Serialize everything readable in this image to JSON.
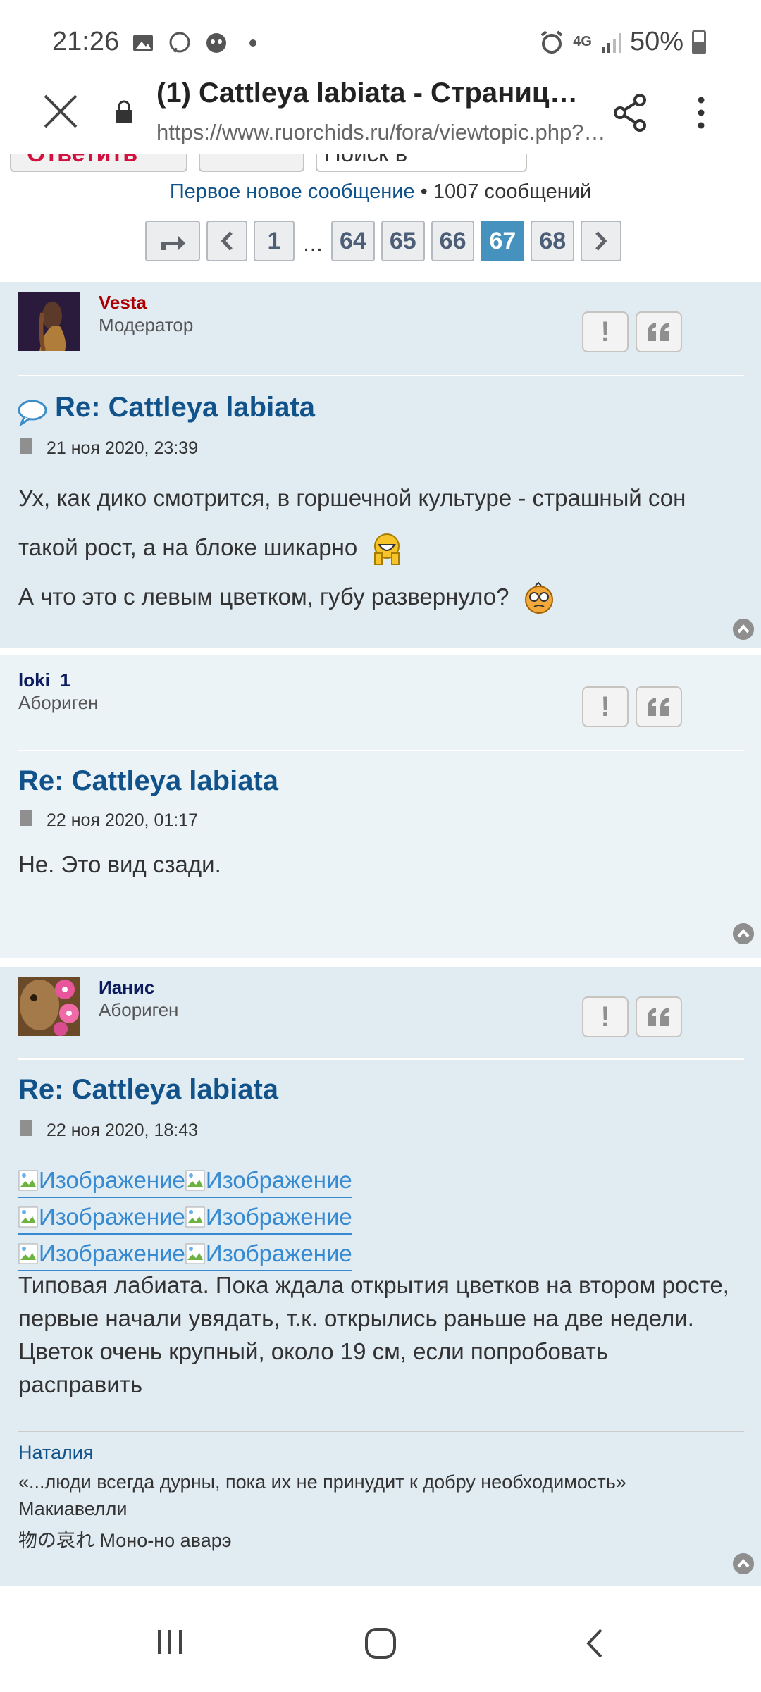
{
  "status_bar": {
    "time": "21:26",
    "battery": "50%",
    "network": "4G",
    "icons_left": [
      "image-icon",
      "viber-icon",
      "ghost-icon",
      "dot-icon"
    ],
    "icons_right": [
      "alarm-icon",
      "data-4g-icon",
      "signal-icon",
      "battery-icon"
    ]
  },
  "browser": {
    "title": "(1) Cattleya labiata - Страница 6…",
    "url": "https://www.ruorchids.ru/fora/viewtopic.php?…"
  },
  "toolbar": {
    "reply_label": "Ответить",
    "search_placeholder": "Поиск в"
  },
  "topic_info": {
    "first_new": "Первое новое сообщение",
    "separator": " • ",
    "count": "1007 сообщений"
  },
  "pagination": {
    "pages": [
      "1",
      "64",
      "65",
      "66",
      "67",
      "68"
    ],
    "ellipsis": "…",
    "current_page": "67"
  },
  "posts": [
    {
      "author": "Vesta",
      "author_color": "#aa0000",
      "rank": "Модератор",
      "title": "Re: Cattleya labiata",
      "date": "21 ноя 2020, 23:39",
      "lines": [
        "Ух, как дико смотрится, в горшечной культуре - страшный сон",
        "такой рост, а на блоке шикарно",
        "А что это с левым цветком, губу развернуло?"
      ]
    },
    {
      "author": "loki_1",
      "author_color": "#0b1b5e",
      "rank": "Абориген",
      "title": "Re: Cattleya labiata",
      "date": "22 ноя 2020, 01:17",
      "lines": [
        "Не. Это вид сзади."
      ]
    },
    {
      "author": "Ианис",
      "author_color": "#0b1b5e",
      "rank": "Абориген",
      "title": "Re: Cattleya labiata",
      "date": "22 ноя 2020, 18:43",
      "image_alt": "Изображение",
      "text": "Типовая лабиата. Пока ждала открытия цветков на втором росте, первые начали увядать, т.к. открылись раньше на две недели. Цветок очень крупный, около 19 см, если попробовать расправить",
      "signature": {
        "name": "Наталия",
        "quote": "«...люди всегда дурны, пока их не принудит к добру необходимость»",
        "quote_author": "Макиавелли",
        "phrase": "物の哀れ Моно-но аварэ"
      }
    }
  ],
  "colors": {
    "post_bg_dark": "#e1ebf2",
    "post_bg_light": "#ecf3f7",
    "link_blue": "#105289",
    "page_active": "#4692bf"
  }
}
